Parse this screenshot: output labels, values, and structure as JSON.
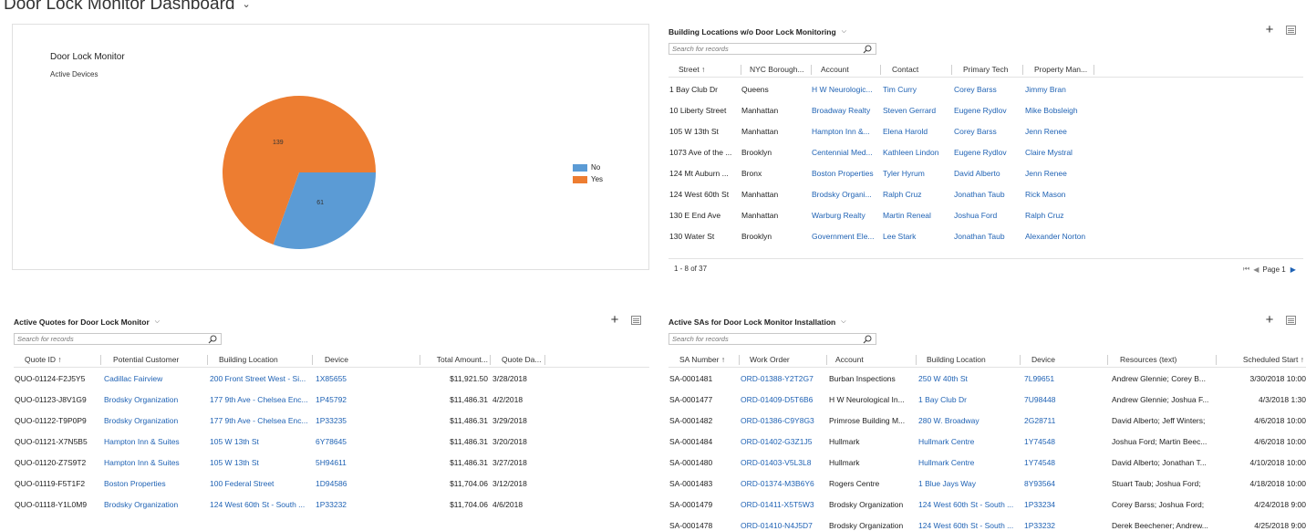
{
  "dashboard": {
    "title": "Door Lock Monitor Dashboard"
  },
  "chart": {
    "title": "Door Lock Monitor",
    "subtitle": "Active Devices"
  },
  "chart_data": {
    "type": "pie",
    "title": "Door Lock Monitor",
    "subtitle": "Active Devices",
    "slices": [
      {
        "label": "No",
        "value": 61,
        "color": "#5b9bd5"
      },
      {
        "label": "Yes",
        "value": 139,
        "color": "#ed7d31"
      }
    ],
    "legend_position": "right"
  },
  "buildings": {
    "title": "Building Locations w/o Door Lock Monitoring",
    "search_placeholder": "Search for records",
    "columns": [
      "Street ↑",
      "NYC Borough...",
      "Account",
      "Contact",
      "Primary Tech",
      "Property Man..."
    ],
    "rows": [
      [
        "1 Bay Club Dr",
        "Queens",
        "H W Neurologic...",
        "Tim Curry",
        "Corey Barss",
        "Jimmy Bran"
      ],
      [
        "10 Liberty Street",
        "Manhattan",
        "Broadway Realty",
        "Steven Gerrard",
        "Eugene Rydlov",
        "Mike Bobsleigh"
      ],
      [
        "105 W 13th St",
        "Manhattan",
        "Hampton Inn &...",
        "Elena Harold",
        "Corey Barss",
        "Jenn Renee"
      ],
      [
        "1073 Ave of the ...",
        "Brooklyn",
        "Centennial Med...",
        "Kathleen Lindon",
        "Eugene Rydlov",
        "Claire Mystral"
      ],
      [
        "124 Mt Auburn ...",
        "Bronx",
        "Boston Properties",
        "Tyler Hyrum",
        "David Alberto",
        "Jenn Renee"
      ],
      [
        "124 West 60th St",
        "Manhattan",
        "Brodsky Organi...",
        "Ralph Cruz",
        "Jonathan Taub",
        "Rick Mason"
      ],
      [
        "130 E End Ave",
        "Manhattan",
        "Warburg Realty",
        "Martin Reneal",
        "Joshua Ford",
        "Ralph Cruz"
      ],
      [
        "130 Water St",
        "Brooklyn",
        "Government Ele...",
        "Lee Stark",
        "Jonathan Taub",
        "Alexander Norton"
      ]
    ],
    "count": "1 - 8 of 37",
    "page": "Page 1"
  },
  "quotes": {
    "title": "Active Quotes for Door Lock Monitor",
    "search_placeholder": "Search for records",
    "columns": [
      "Quote ID ↑",
      "Potential Customer",
      "Building Location",
      "Device",
      "Total Amount...",
      "Quote Da..."
    ],
    "rows": [
      [
        "QUO-01124-F2J5Y5",
        "Cadillac Fairview",
        "200 Front Street West - Si...",
        "1X85655",
        "$11,921.50",
        "3/28/2018"
      ],
      [
        "QUO-01123-J8V1G9",
        "Brodsky Organization",
        "177 9th Ave - Chelsea Enc...",
        "1P45792",
        "$11,486.31",
        "4/2/2018"
      ],
      [
        "QUO-01122-T9P0P9",
        "Brodsky Organization",
        "177 9th Ave - Chelsea Enc...",
        "1P33235",
        "$11,486.31",
        "3/29/2018"
      ],
      [
        "QUO-01121-X7N5B5",
        "Hampton Inn & Suites",
        "105 W 13th St",
        "6Y78645",
        "$11,486.31",
        "3/20/2018"
      ],
      [
        "QUO-01120-Z7S9T2",
        "Hampton Inn & Suites",
        "105 W 13th St",
        "5H94611",
        "$11,486.31",
        "3/27/2018"
      ],
      [
        "QUO-01119-F5T1F2",
        "Boston Properties",
        "100 Federal Street",
        "1D94586",
        "$11,704.06",
        "3/12/2018"
      ],
      [
        "QUO-01118-Y1L0M9",
        "Brodsky Organization",
        "124 West 60th St - South ...",
        "1P33232",
        "$11,704.06",
        "4/6/2018"
      ]
    ]
  },
  "sas": {
    "title": "Active SAs for Door Lock Monitor Installation",
    "search_placeholder": "Search for records",
    "columns": [
      "SA Number ↑",
      "Work Order",
      "Account",
      "Building Location",
      "Device",
      "Resources (text)",
      "Scheduled Start ↑"
    ],
    "rows": [
      [
        "SA-0001481",
        "ORD-01388-Y2T2G7",
        "Burban Inspections",
        "250 W 40th St",
        "7L99651",
        "Andrew Glennie; Corey B...",
        "3/30/2018 10:00"
      ],
      [
        "SA-0001477",
        "ORD-01409-D5T6B6",
        "H W Neurological In...",
        "1 Bay Club Dr",
        "7U98448",
        "Andrew Glennie; Joshua F...",
        "4/3/2018 1:30"
      ],
      [
        "SA-0001482",
        "ORD-01386-C9Y8G3",
        "Primrose Building M...",
        "280 W. Broadway",
        "2G28711",
        "David Alberto; Jeff Winters;",
        "4/6/2018 10:00"
      ],
      [
        "SA-0001484",
        "ORD-01402-G3Z1J5",
        "Hullmark",
        "Hullmark Centre",
        "1Y74548",
        "Joshua Ford; Martin Beec...",
        "4/6/2018 10:00"
      ],
      [
        "SA-0001480",
        "ORD-01403-V5L3L8",
        "Hullmark",
        "Hullmark Centre",
        "1Y74548",
        "David Alberto; Jonathan T...",
        "4/10/2018 10:00"
      ],
      [
        "SA-0001483",
        "ORD-01374-M3B6Y6",
        "Rogers Centre",
        "1 Blue Jays Way",
        "8Y93564",
        "Stuart Taub; Joshua Ford;",
        "4/18/2018 10:00"
      ],
      [
        "SA-0001479",
        "ORD-01411-X5T5W3",
        "Brodsky Organization",
        "124 West 60th St - South ...",
        "1P33234",
        "Corey Barss; Joshua Ford;",
        "4/24/2018 9:00"
      ],
      [
        "SA-0001478",
        "ORD-01410-N4J5D7",
        "Brodsky Organization",
        "124 West 60th St - South ...",
        "1P33232",
        "Derek Beechener; Andrew...",
        "4/25/2018 9:00"
      ]
    ]
  }
}
